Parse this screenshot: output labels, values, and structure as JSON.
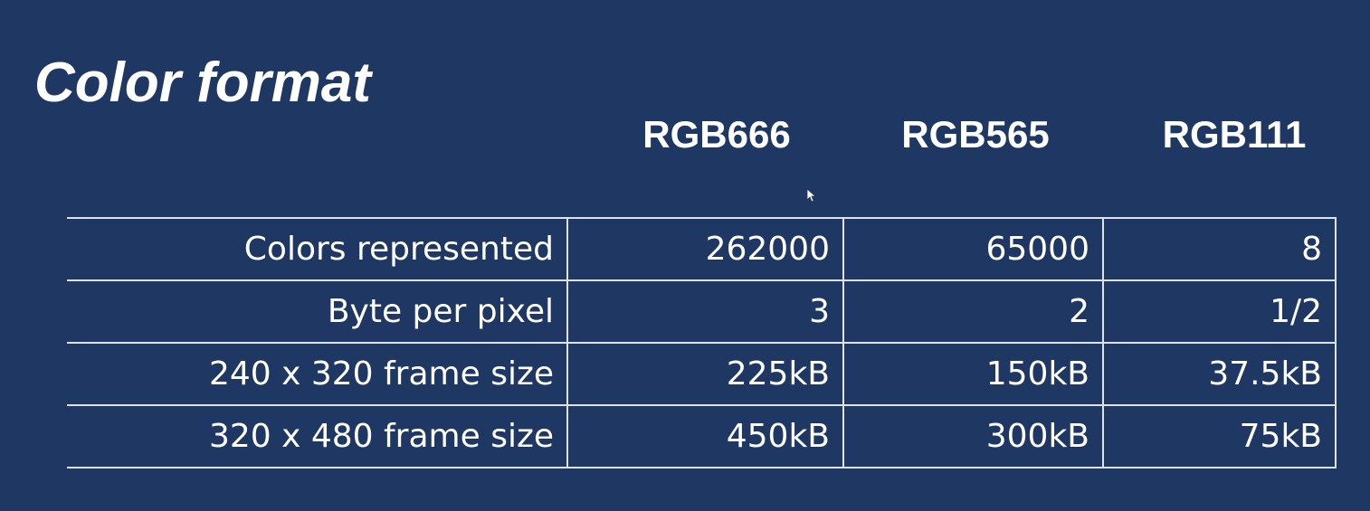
{
  "slide": {
    "title": "Color format"
  },
  "table": {
    "columns": [
      "RGB666",
      "RGB565",
      "RGB111"
    ],
    "rows": [
      {
        "label": "Colors represented",
        "values": [
          "262000",
          "65000",
          "8"
        ]
      },
      {
        "label": "Byte per pixel",
        "values": [
          "3",
          "2",
          "1/2"
        ]
      },
      {
        "label": "240 x 320 frame size",
        "values": [
          "225kB",
          "150kB",
          "37.5kB"
        ]
      },
      {
        "label": "320 x 480 frame size",
        "values": [
          "450kB",
          "300kB",
          "75kB"
        ]
      }
    ]
  },
  "colors": {
    "background": "#1f3763",
    "text": "#ffffff",
    "grid": "#dce3ee"
  }
}
